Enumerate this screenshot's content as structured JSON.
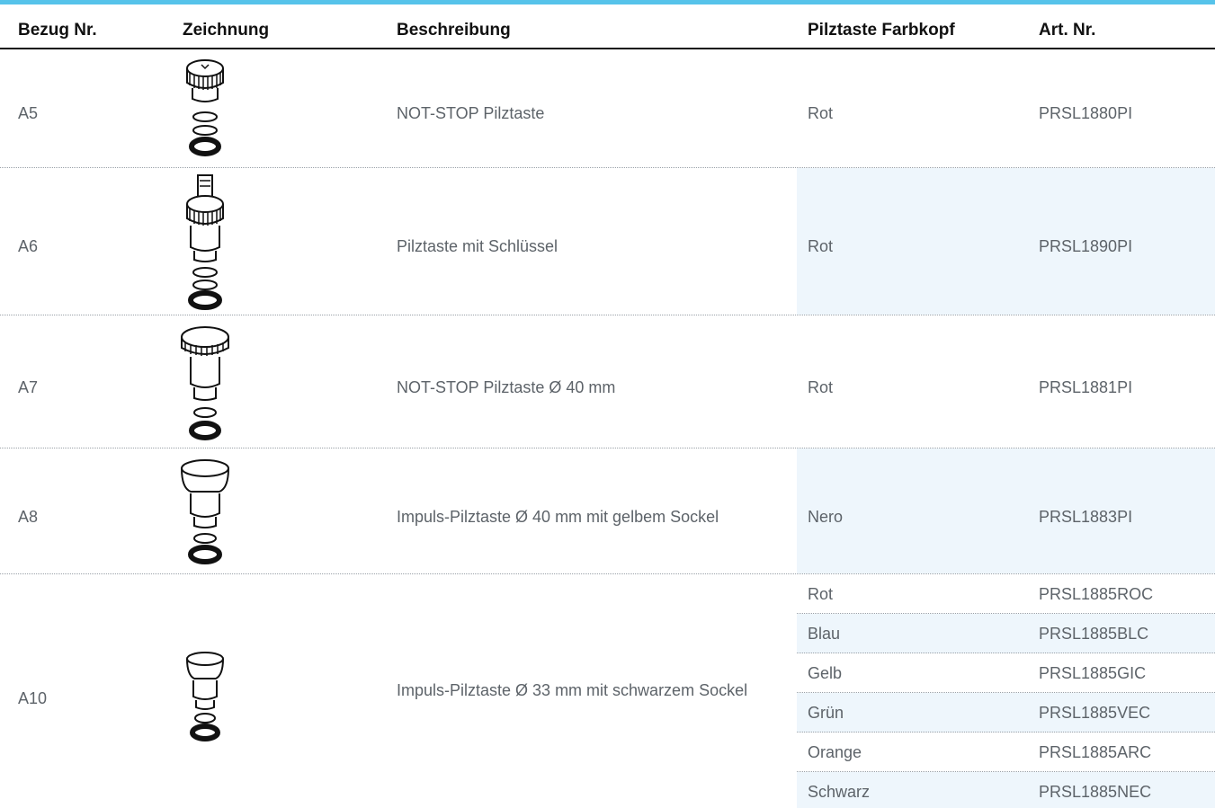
{
  "header": {
    "ref": "Bezug Nr.",
    "drawing": "Zeichnung",
    "description": "Beschreibung",
    "color": "Pilztaste Farbkopf",
    "article": "Art. Nr."
  },
  "rows": [
    {
      "ref": "A5",
      "drawing_icon": "emergency-stop-mushroom-button-icon",
      "description": "NOT-STOP Pilztaste",
      "color": "Rot",
      "article": "PRSL1880PI"
    },
    {
      "ref": "A6",
      "drawing_icon": "key-mushroom-button-icon",
      "description": "Pilztaste mit Schlüssel",
      "color": "Rot",
      "article": "PRSL1890PI"
    },
    {
      "ref": "A7",
      "drawing_icon": "emergency-stop-40mm-button-icon",
      "description": "NOT-STOP Pilztaste Ø 40 mm",
      "color": "Rot",
      "article": "PRSL1881PI"
    },
    {
      "ref": "A8",
      "drawing_icon": "impulse-mushroom-40mm-button-icon",
      "description": "Impuls-Pilztaste Ø 40 mm mit gelbem Sockel",
      "color": "Nero",
      "article": "PRSL1883PI"
    },
    {
      "ref": "A10",
      "drawing_icon": "impulse-mushroom-33mm-button-icon",
      "description": "Impuls-Pilztaste Ø 33 mm mit schwarzem Sockel",
      "variants": [
        {
          "color": "Rot",
          "article": "PRSL1885ROC"
        },
        {
          "color": "Blau",
          "article": "PRSL1885BLC"
        },
        {
          "color": "Gelb",
          "article": "PRSL1885GIC"
        },
        {
          "color": "Grün",
          "article": "PRSL1885VEC"
        },
        {
          "color": "Orange",
          "article": "PRSL1885ARC"
        },
        {
          "color": "Schwarz",
          "article": "PRSL1885NEC"
        }
      ]
    }
  ],
  "colors": {
    "accent_bar": "#56c3ea",
    "row_shade": "#eef6fc",
    "text": "#5d6369",
    "header_text": "#111111"
  }
}
